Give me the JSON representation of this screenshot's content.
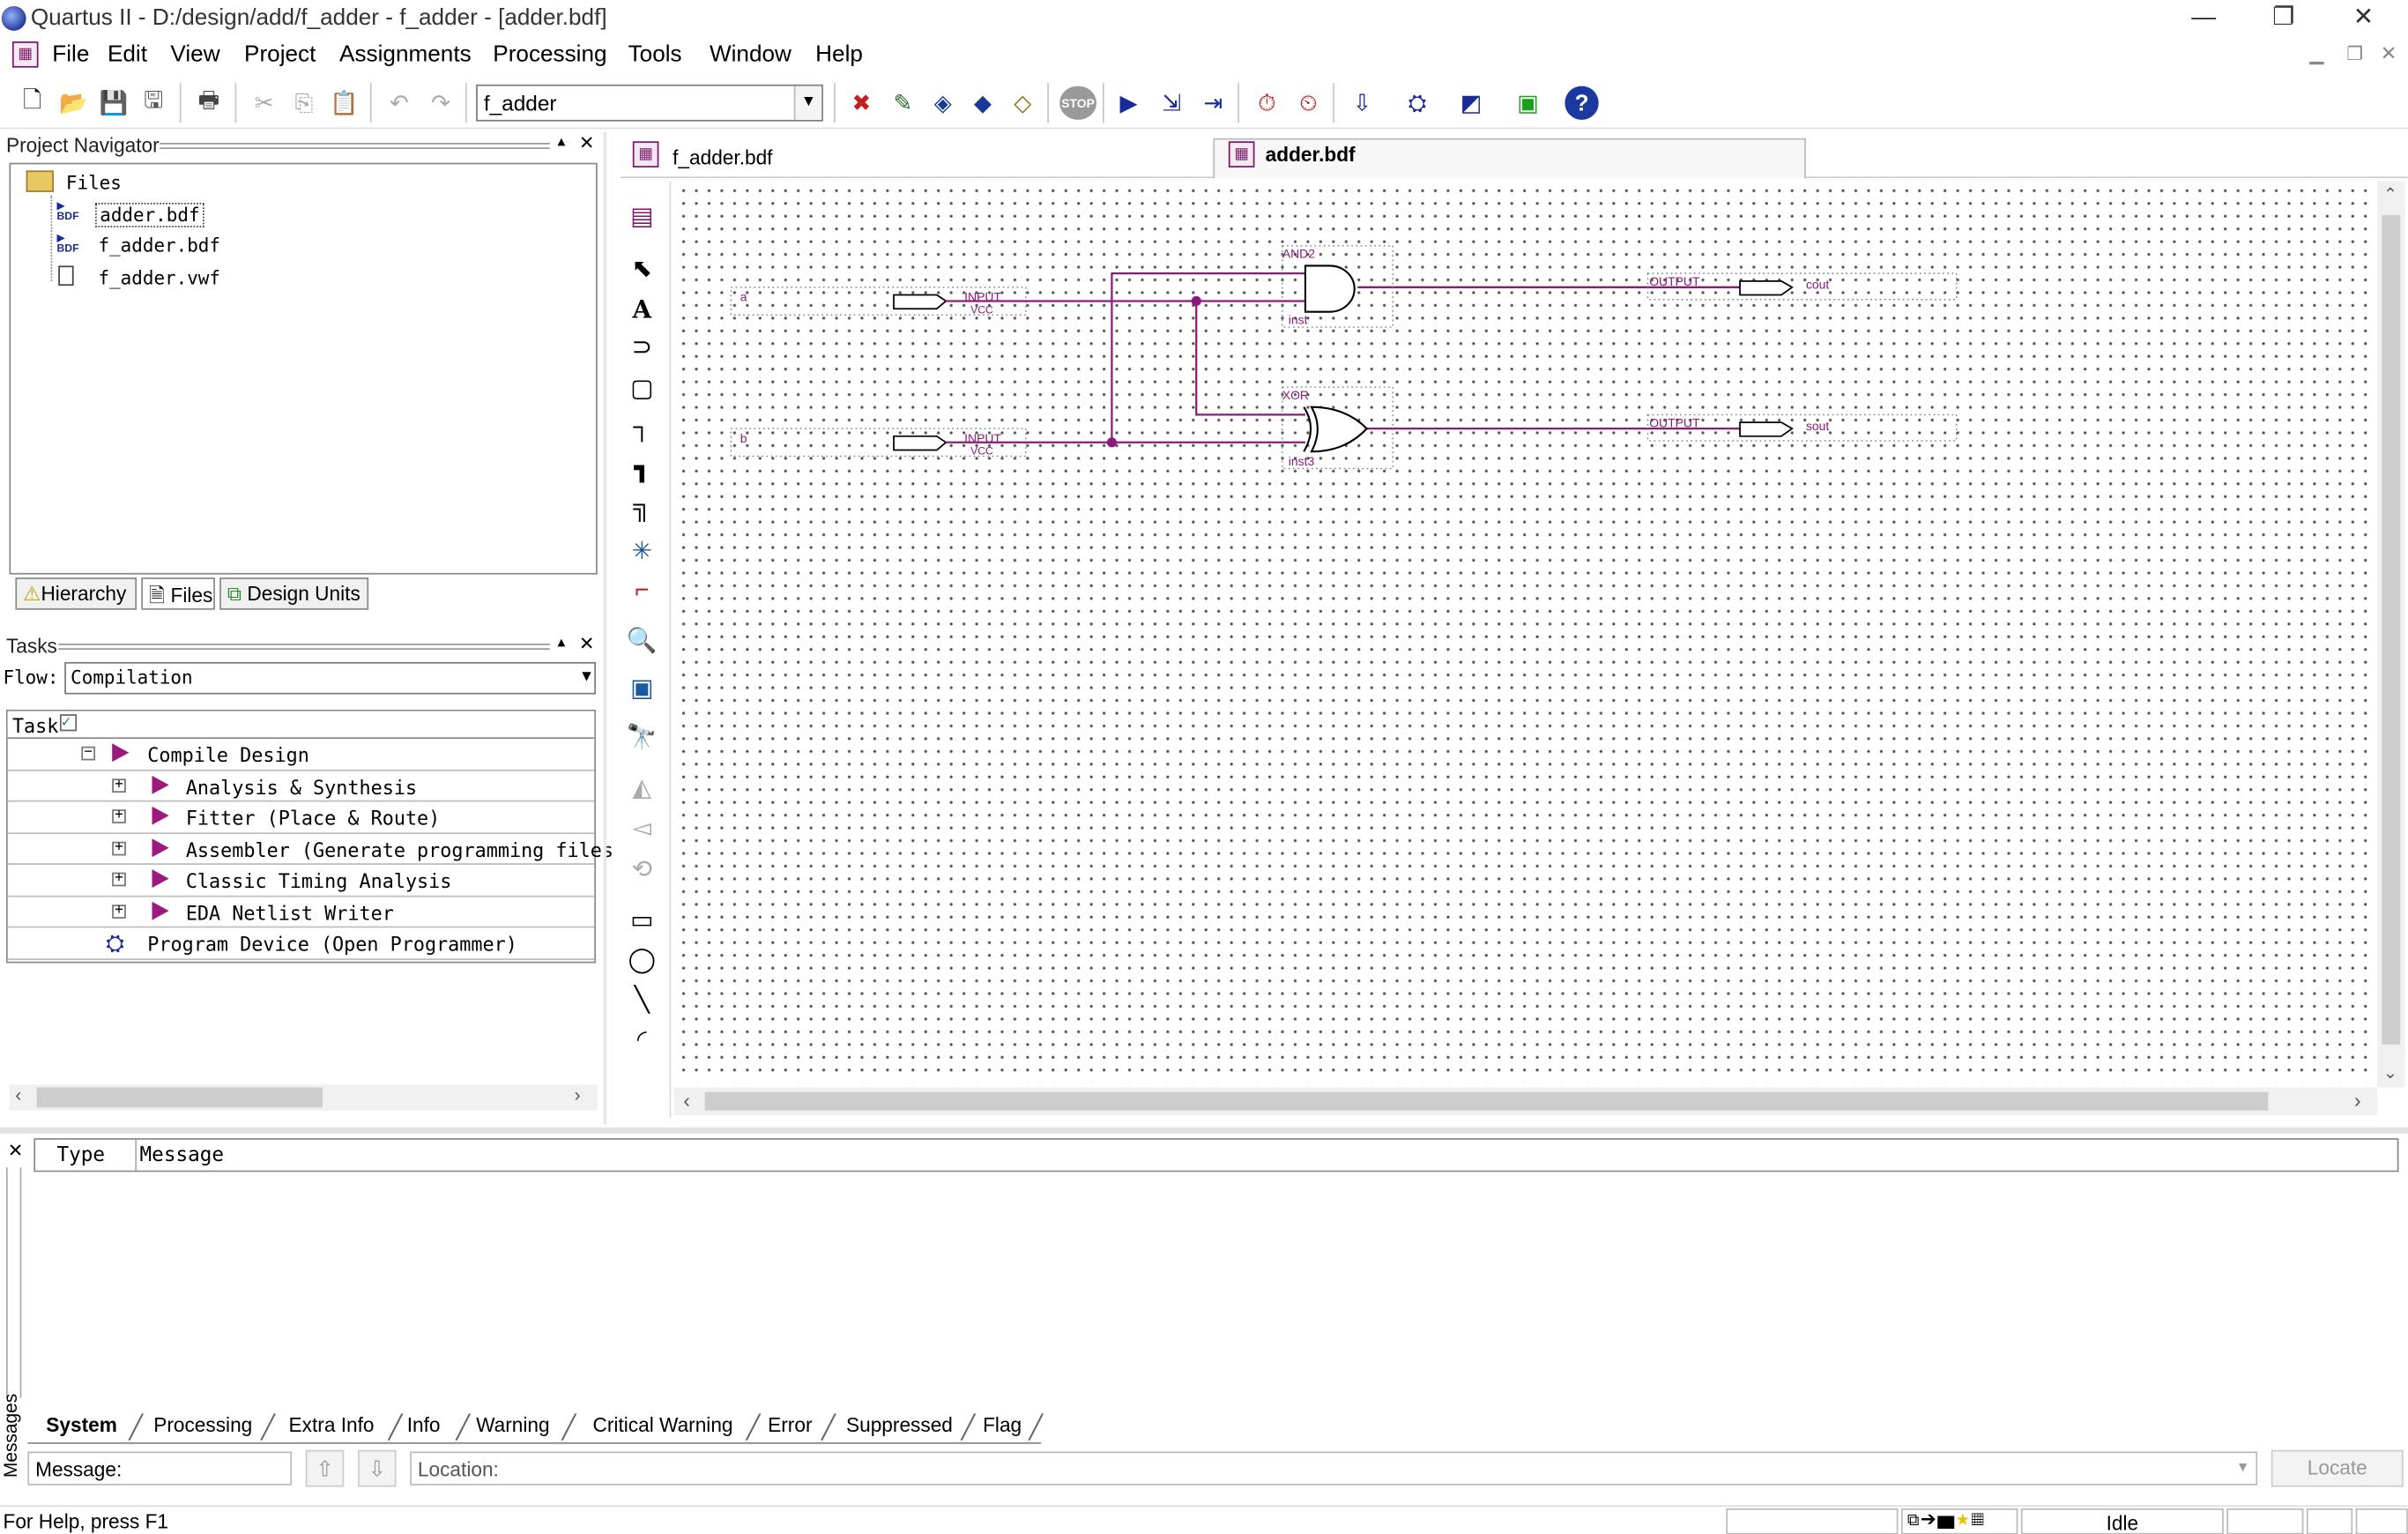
{
  "window": {
    "title": "Quartus II - D:/design/add/f_adder - f_adder - [adder.bdf]",
    "controls": {
      "minimize": "—",
      "restore": "❐",
      "close": "✕"
    }
  },
  "menu": {
    "items": [
      "File",
      "Edit",
      "View",
      "Project",
      "Assignments",
      "Processing",
      "Tools",
      "Window",
      "Help"
    ]
  },
  "toolbar": {
    "project_combo": "f_adder"
  },
  "project_navigator": {
    "title": "Project Navigator",
    "root": "Files",
    "files": [
      "adder.bdf",
      "f_adder.bdf",
      "f_adder.vwf"
    ],
    "file_icon_tag": "BDF",
    "tabs": [
      "Hierarchy",
      "Files",
      "Design Units"
    ]
  },
  "tasks": {
    "title": "Tasks",
    "flow_label": "Flow:",
    "flow_value": "Compilation",
    "header": "Task",
    "rows": [
      {
        "label": "Compile Design"
      },
      {
        "label": "Analysis & Synthesis"
      },
      {
        "label": "Fitter (Place & Route)"
      },
      {
        "label": "Assembler (Generate programming files)"
      },
      {
        "label": "Classic Timing Analysis"
      },
      {
        "label": "EDA Netlist Writer"
      },
      {
        "label": "Program Device (Open Programmer)"
      }
    ]
  },
  "editor": {
    "tabs": [
      "f_adder.bdf",
      "adder.bdf"
    ],
    "active_tab": "adder.bdf"
  },
  "schematic": {
    "pins": {
      "in_a": {
        "name": "a",
        "type": "INPUT",
        "default": "VCC"
      },
      "in_b": {
        "name": "b",
        "type": "INPUT",
        "default": "VCC"
      },
      "out_cout": {
        "name": "cout",
        "type": "OUTPUT"
      },
      "out_sout": {
        "name": "sout",
        "type": "OUTPUT"
      }
    },
    "gates": {
      "and": {
        "type": "AND2",
        "instance": "inst"
      },
      "xor": {
        "type": "XOR",
        "instance": "inst3"
      }
    },
    "wire_color": "#8b1a7a"
  },
  "messages": {
    "side_label": "Messages",
    "columns": [
      "Type",
      "Message"
    ],
    "tabs": [
      "System",
      "Processing",
      "Extra Info",
      "Info",
      "Warning",
      "Critical Warning",
      "Error",
      "Suppressed",
      "Flag"
    ],
    "active_tab": "System",
    "message_label": "Message:",
    "location_placeholder": "Location:",
    "locate_button": "Locate"
  },
  "status": {
    "help_text": "For Help, press F1",
    "state": "Idle"
  }
}
